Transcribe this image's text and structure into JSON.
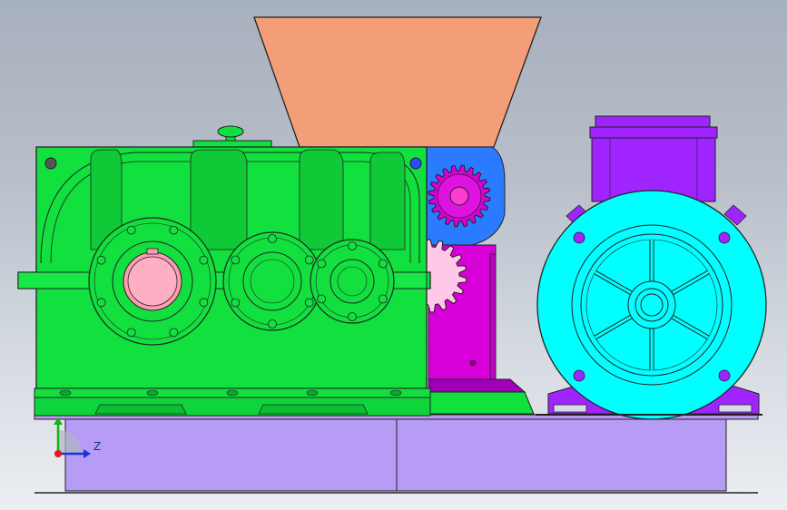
{
  "viewport": {
    "background_top": "#a7b0bd",
    "background_bottom": "#eceef2"
  },
  "model": {
    "parts": [
      {
        "name": "feed-hopper",
        "color": "#f39e78"
      },
      {
        "name": "gear-reducer-housing",
        "color": "#12e03f"
      },
      {
        "name": "crusher-chamber",
        "color": "#d800d8"
      },
      {
        "name": "drive-gear",
        "color": "#ff3cd1"
      },
      {
        "name": "crusher-gear",
        "color": "#ffc8e8"
      },
      {
        "name": "electric-motor-fan-cover",
        "color": "#00ffff"
      },
      {
        "name": "electric-motor-terminal-box",
        "color": "#a024ff"
      },
      {
        "name": "base-frame",
        "color": "#b69cf5"
      },
      {
        "name": "output-shaft-bore",
        "color": "#ff9ab3"
      }
    ]
  },
  "triad": {
    "axis_z_label": "Z",
    "x_color": "#e01b1b",
    "y_color": "#13b31a",
    "z_color": "#1a34d8"
  }
}
